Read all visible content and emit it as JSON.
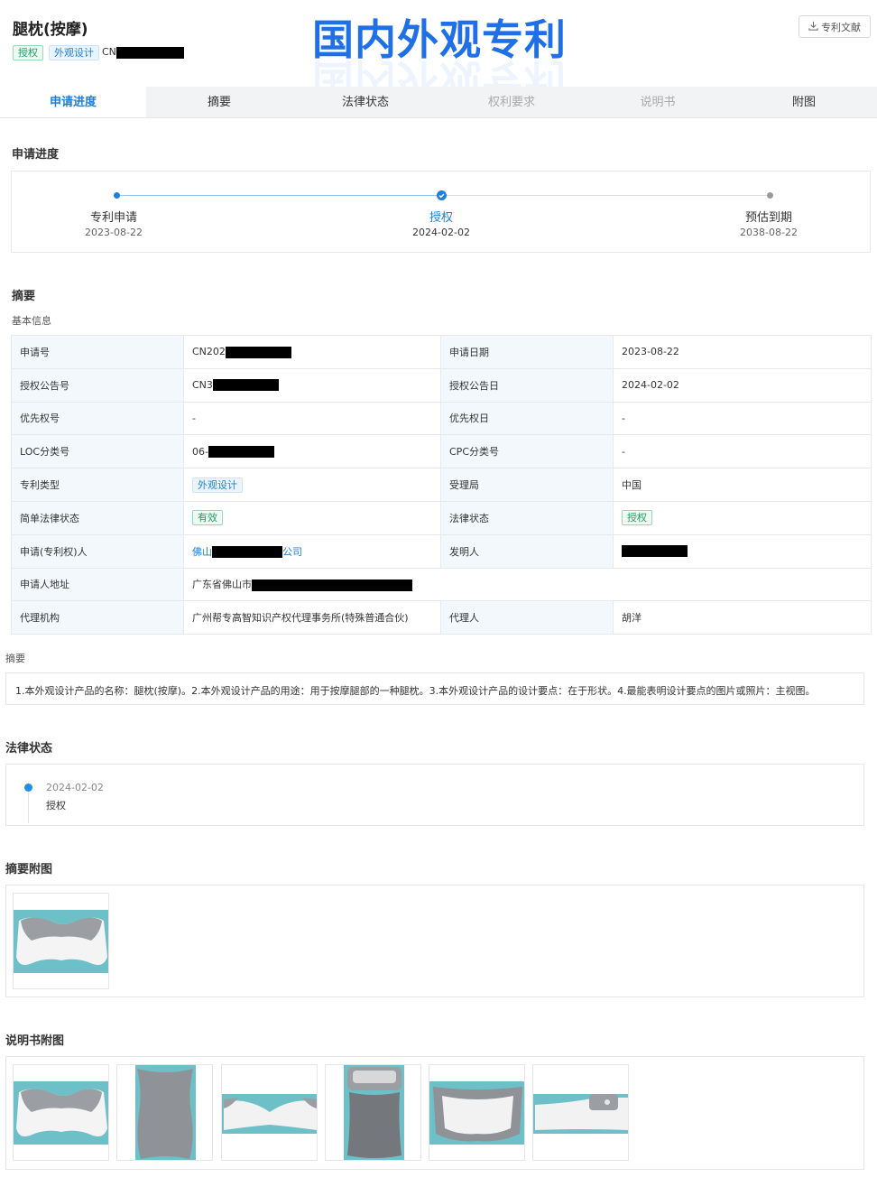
{
  "header": {
    "title": "腿枕(按摩)",
    "tags": [
      "授权",
      "外观设计"
    ],
    "patent_number_prefix": "CN",
    "banner": "国内外观专利",
    "doc_button": "专利文献"
  },
  "tabs": [
    {
      "label": "申请进度",
      "state": "active"
    },
    {
      "label": "摘要",
      "state": "normal"
    },
    {
      "label": "法律状态",
      "state": "normal"
    },
    {
      "label": "权利要求",
      "state": "disabled"
    },
    {
      "label": "说明书",
      "state": "disabled"
    },
    {
      "label": "附图",
      "state": "normal"
    }
  ],
  "progress": {
    "title": "申请进度",
    "steps": [
      {
        "label": "专利申请",
        "date": "2023-08-22"
      },
      {
        "label": "授权",
        "date": "2024-02-02"
      },
      {
        "label": "预估到期",
        "date": "2038-08-22"
      }
    ]
  },
  "summary": {
    "title": "摘要",
    "basic_info_title": "基本信息",
    "rows": [
      {
        "l1": "申请号",
        "v1": "CN202",
        "l2": "申请日期",
        "v2": "2023-08-22"
      },
      {
        "l1": "授权公告号",
        "v1": "CN3",
        "l2": "授权公告日",
        "v2": "2024-02-02"
      },
      {
        "l1": "优先权号",
        "v1": "-",
        "l2": "优先权日",
        "v2": "-"
      },
      {
        "l1": "LOC分类号",
        "v1": "06-",
        "l2": "CPC分类号",
        "v2": "-"
      },
      {
        "l1": "专利类型",
        "v1": "外观设计",
        "l2": "受理局",
        "v2": "中国"
      },
      {
        "l1": "简单法律状态",
        "v1": "有效",
        "l2": "法律状态",
        "v2": "授权"
      },
      {
        "l1": "申请(专利权)人",
        "v1_prefix": "佛山",
        "v1_suffix": "公司",
        "l2": "发明人",
        "v2": ""
      },
      {
        "l1": "申请人地址",
        "v1": "广东省佛山市"
      },
      {
        "l1": "代理机构",
        "v1": "广州帮专高智知识产权代理事务所(特殊普通合伙)",
        "l2": "代理人",
        "v2": "胡洋"
      }
    ],
    "abstract_label": "摘要",
    "abstract_text": "1.本外观设计产品的名称：腿枕(按摩)。2.本外观设计产品的用途：用于按摩腿部的一种腿枕。3.本外观设计产品的设计要点：在于形状。4.最能表明设计要点的图片或照片：主视图。"
  },
  "legal": {
    "title": "法律状态",
    "events": [
      {
        "date": "2024-02-02",
        "status": "授权"
      }
    ]
  },
  "abstract_images": {
    "title": "摘要附图"
  },
  "spec_images": {
    "title": "说明书附图"
  },
  "colors": {
    "accent": "#1f7fd6",
    "green": "#1aa15f",
    "banner": "#1f6fe6",
    "teal_bg": "#6ec0c8"
  }
}
